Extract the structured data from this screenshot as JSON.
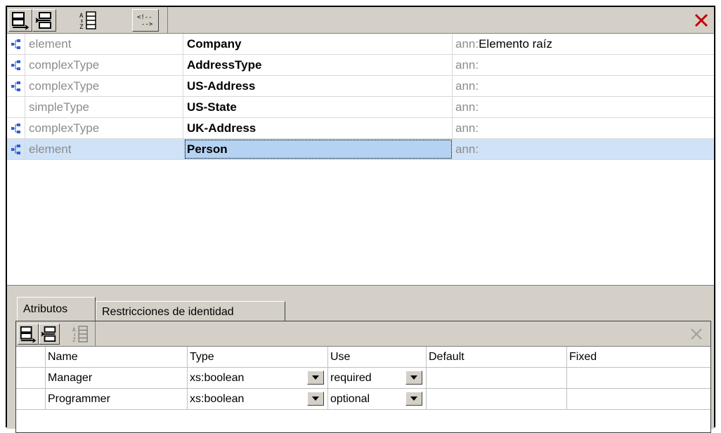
{
  "toolbar": {
    "buttons": [
      {
        "icon": "append-row-icon"
      },
      {
        "icon": "insert-row-icon"
      },
      {
        "icon": "sort-az-icon"
      },
      {
        "icon": "comment-icon"
      }
    ],
    "close_icon": "close-icon"
  },
  "components": [
    {
      "icon": "component-tree-icon",
      "kind": "element",
      "name": "Company",
      "ann_prefix": "ann:",
      "ann_value": "Elemento raíz"
    },
    {
      "icon": "component-tree-icon",
      "kind": "complexType",
      "name": "AddressType",
      "ann_prefix": "ann:",
      "ann_value": ""
    },
    {
      "icon": "component-tree-icon",
      "kind": "complexType",
      "name": "US-Address",
      "ann_prefix": "ann:",
      "ann_value": ""
    },
    {
      "icon": "",
      "kind": "simpleType",
      "name": "US-State",
      "ann_prefix": "ann:",
      "ann_value": ""
    },
    {
      "icon": "component-tree-icon",
      "kind": "complexType",
      "name": "UK-Address",
      "ann_prefix": "ann:",
      "ann_value": ""
    },
    {
      "icon": "component-tree-icon",
      "kind": "element",
      "name": "Person",
      "ann_prefix": "ann:",
      "ann_value": "",
      "selected": true
    }
  ],
  "lower": {
    "tabs": [
      {
        "label": "Atributos",
        "active": true
      },
      {
        "label": "Restricciones de identidad",
        "active": false
      }
    ],
    "attributes": {
      "columns": [
        "",
        "Name",
        "Type",
        "Use",
        "Default",
        "Fixed"
      ],
      "rows": [
        {
          "name": "Manager",
          "type": "xs:boolean",
          "use": "required",
          "default": "",
          "fixed": ""
        },
        {
          "name": "Programmer",
          "type": "xs:boolean",
          "use": "optional",
          "default": "",
          "fixed": ""
        }
      ]
    }
  }
}
